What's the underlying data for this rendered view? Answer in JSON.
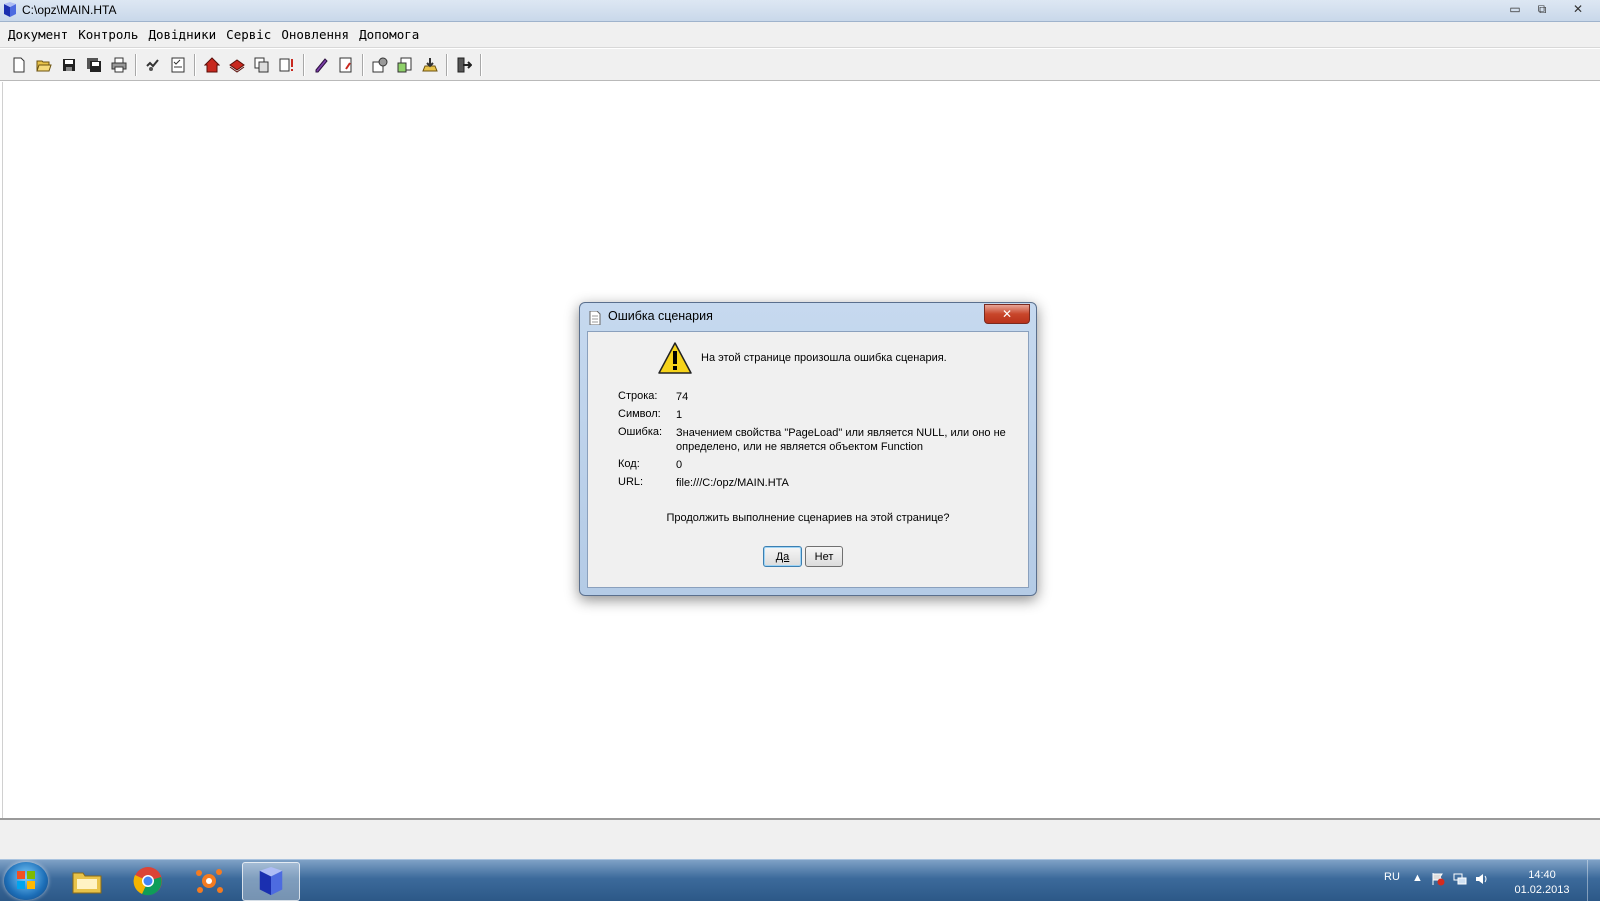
{
  "window": {
    "title": "C:\\opz\\MAIN.HTA",
    "minimize": "▭",
    "maximize": "⧉",
    "close": "✕"
  },
  "menu": {
    "items": [
      "Документ",
      "Контроль",
      "Довідники",
      "Сервіс",
      "Оновлення",
      "Допомога"
    ]
  },
  "dialog": {
    "title": "Ошибка сценария",
    "close": "✕",
    "message": "На этой странице произошла ошибка сценария.",
    "fields": [
      {
        "label": "Строка:",
        "value": "74"
      },
      {
        "label": "Символ:",
        "value": "1"
      },
      {
        "label": "Ошибка:",
        "value": "Значением свойства \"PageLoad\" или является NULL, или оно не определено, или не является объектом Function"
      },
      {
        "label": "Код:",
        "value": "0"
      },
      {
        "label": "URL:",
        "value": "file:///C:/opz/MAIN.HTA"
      }
    ],
    "question": "Продолжить выполнение сценариев на этой странице?",
    "yes": "Да",
    "no": "Нет"
  },
  "taskbar": {
    "lang": "RU",
    "time": "14:40",
    "date": "01.02.2013"
  },
  "colors": {
    "accent": "#3c6a9b",
    "warning": "#f6d31a"
  }
}
